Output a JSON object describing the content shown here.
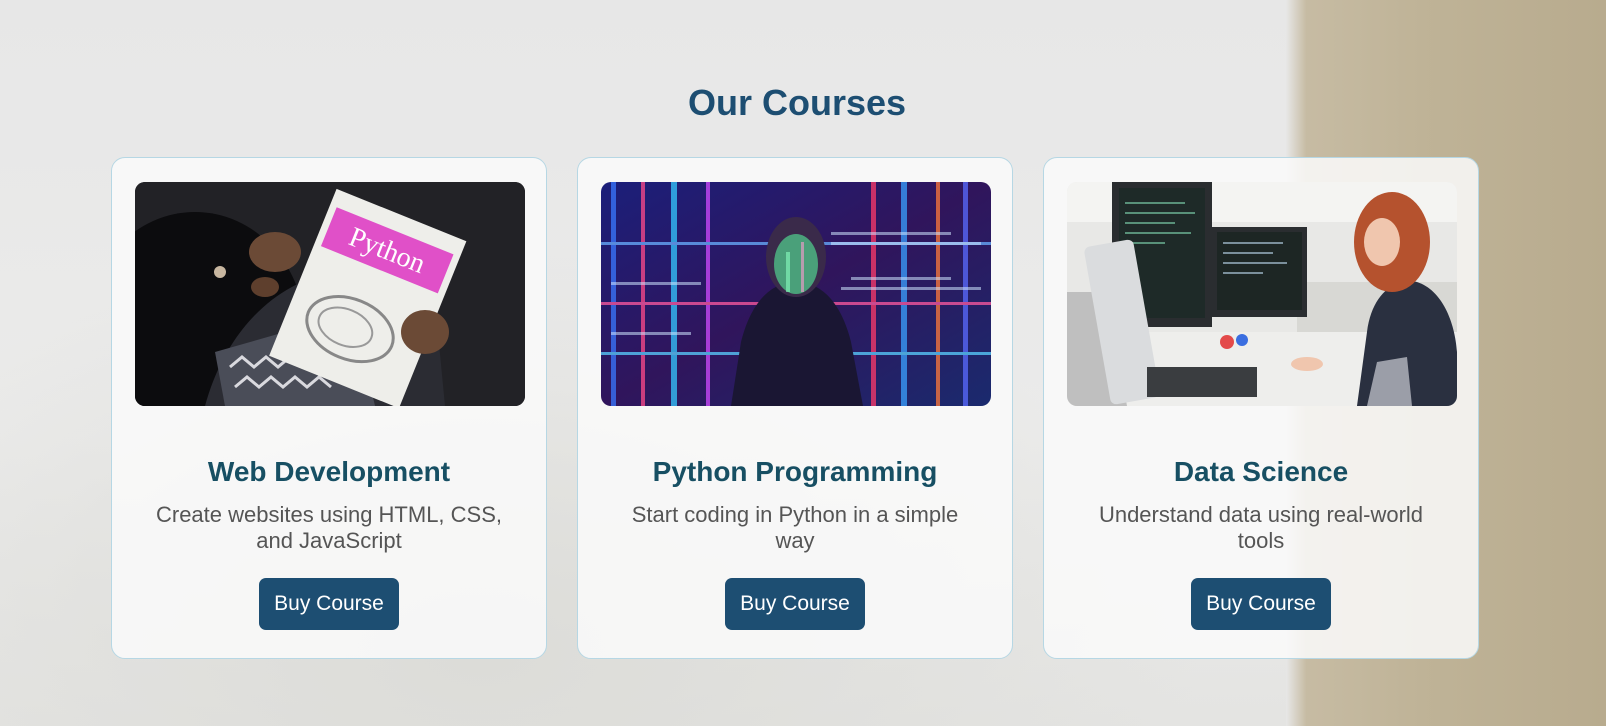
{
  "section": {
    "title": "Our Courses"
  },
  "colors": {
    "title": "#1d4e72",
    "card_title": "#174f63",
    "button_bg": "#1d4e72",
    "button_text": "#ffffff",
    "card_border": "#b6d7e4"
  },
  "courses": [
    {
      "title": "Web Development",
      "description": "Create websites using HTML, CSS, and JavaScript",
      "button_label": "Buy Course",
      "image": "person-holding-python-book-photo"
    },
    {
      "title": "Python Programming",
      "description": "Start coding in Python in a simple way",
      "button_label": "Buy Course",
      "image": "woman-with-projected-code-photo",
      "book_title": "Python"
    },
    {
      "title": "Data Science",
      "description": "Understand data using real-world tools",
      "button_label": "Buy Course",
      "image": "woman-at-computer-monitors-photo"
    }
  ]
}
